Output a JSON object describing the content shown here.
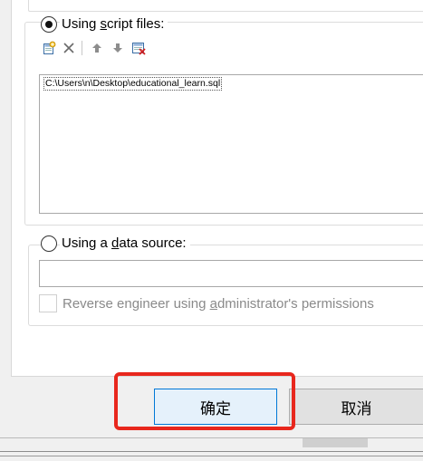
{
  "script_files": {
    "radio_selected": true,
    "label_pre": "Using ",
    "label_accel": "s",
    "label_post": "cript files:",
    "toolbar": {
      "add_icon": "add-file-icon",
      "delete_icon": "delete-x-icon",
      "up_icon": "arrow-up-icon",
      "down_icon": "arrow-down-icon",
      "clear_icon": "remove-all-icon"
    },
    "files": [
      "C:\\Users\\n\\Desktop\\educational_learn.sql"
    ]
  },
  "data_source": {
    "radio_selected": false,
    "label_pre": "Using a ",
    "label_accel": "d",
    "label_post": "ata source:",
    "input_value": "",
    "reverse_engineer": {
      "checked": false,
      "label_pre": "Reverse engineer using ",
      "label_accel": "a",
      "label_post": "dministrator's permissions"
    }
  },
  "buttons": {
    "ok_label": "确定",
    "cancel_label": "取消"
  },
  "colors": {
    "highlight": "#e8271d",
    "ok_border": "#0078d7"
  }
}
